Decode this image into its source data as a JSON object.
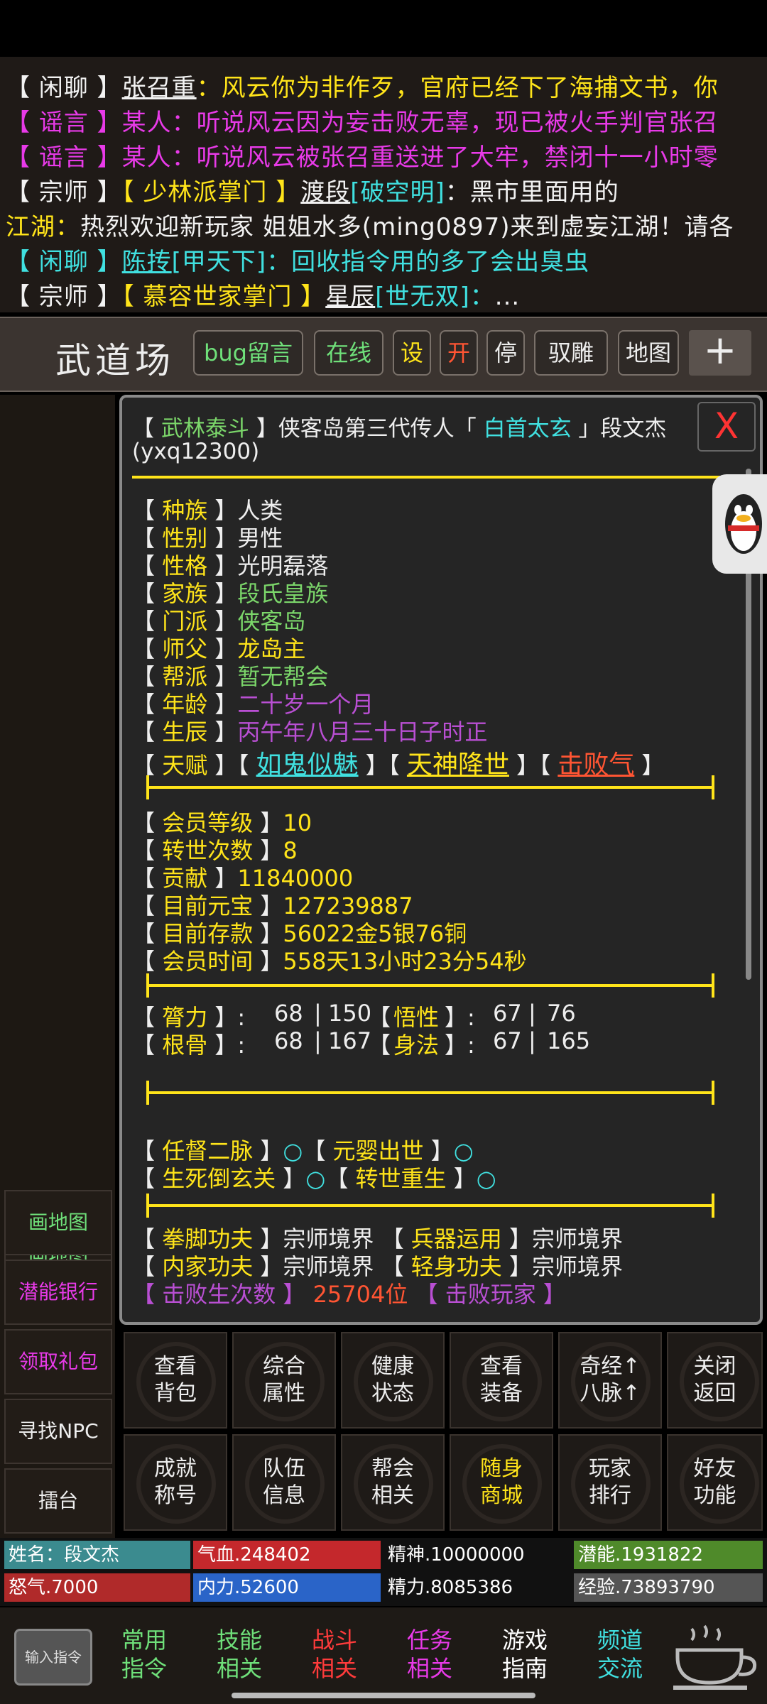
{
  "chat": [
    {
      "tag": "【 闲聊 】",
      "name": "张召重",
      "sep": "：",
      "msg": "风云你为非作歹，官府已经下了海捕文书，你"
    },
    {
      "tag": "【 谣言 】",
      "name": "某人",
      "sep": "：",
      "msg": "听说风云因为妄击败无辜，现已被火手判官张召"
    },
    {
      "tag": "【 谣言 】",
      "name": "某人",
      "sep": "：",
      "msg": "听说风云被张召重送进了大牢，禁闭十一小时零"
    },
    {
      "tag": "【 宗师 】",
      "title": "【 少林派掌门 】",
      "name": "渡段",
      "extra": "[破空明]",
      "sep": "：",
      "msg": "黑市里面用的"
    },
    {
      "tag": "江湖",
      "sep": "：",
      "msg": "热烈欢迎新玩家 姐姐水多(ming0897)来到虚妄江湖！请各"
    },
    {
      "tag": "【 闲聊 】",
      "name": "陈抟",
      "extra": "[甲天下]",
      "sep": "：",
      "msg": "回收指令用的多了会出臭虫"
    },
    {
      "tag": "【 宗师 】",
      "title": "【 慕容世家掌门 】",
      "name": "星辰",
      "extra": "[世无双]",
      "sep": "：",
      "msg": "..."
    }
  ],
  "toolbar": {
    "venue": "武道场",
    "buttons": [
      "bug留言",
      "在线",
      "设",
      "开",
      "停",
      "驭雕",
      "地图"
    ],
    "plus": "+"
  },
  "sidebar": [
    "画地图",
    "潜能银行",
    "领取礼包",
    "寻找NPC",
    "擂台"
  ],
  "profile": {
    "line1_a": "【 ",
    "title": "武林泰斗",
    "line1_b": " 】侠客岛第三代传人「 ",
    "nick": "白首太玄",
    "line1_c": " 」段文杰",
    "id": "(yxq12300)",
    "close": "X",
    "fields": [
      {
        "k": "种族",
        "v": "人类"
      },
      {
        "k": "性别",
        "v": "男性"
      },
      {
        "k": "性格",
        "v": "光明磊落"
      },
      {
        "k": "家族",
        "v": "段氏皇族"
      },
      {
        "k": "门派",
        "v": "侠客岛"
      },
      {
        "k": "师父",
        "v": "龙岛主"
      },
      {
        "k": "帮派",
        "v": "暂无帮会"
      },
      {
        "k": "年龄",
        "v": "二十岁一个月"
      },
      {
        "k": "生辰",
        "v": "丙午年八月三十日子时正"
      }
    ],
    "talent_label": "天赋",
    "talents": [
      "如鬼似魅",
      "天神降世",
      "击败气"
    ],
    "member": [
      {
        "k": "会员等级",
        "v": "10"
      },
      {
        "k": "转世次数",
        "v": "8"
      },
      {
        "k": "贡献",
        "v": "11840000"
      },
      {
        "k": "目前元宝",
        "v": "127239887"
      },
      {
        "k": "目前存款",
        "v": "56022金5银76铜"
      },
      {
        "k": "会员时间",
        "v": "558天13小时23分54秒"
      }
    ],
    "attrs": [
      {
        "k1": "膂力",
        "a": "68",
        "b": "150",
        "k2": "悟性",
        "c": "67",
        "d": "76"
      },
      {
        "k1": "根骨",
        "a": "68",
        "b": "167",
        "k2": "身法",
        "c": "67",
        "d": "165"
      }
    ],
    "states": [
      {
        "a": "任督二脉",
        "b": "元婴出世"
      },
      {
        "a": "生死倒玄关",
        "b": "转世重生"
      }
    ],
    "state_mark": "○",
    "skills": [
      {
        "k1": "拳脚功夫",
        "v1": "宗师境界",
        "k2": "兵器运用",
        "v2": "宗师境界"
      },
      {
        "k1": "内家功夫",
        "v1": "宗师境界",
        "k2": "轻身功夫",
        "v2": "宗师境界"
      }
    ],
    "rank_k1": "击败生次数",
    "rank_v1": "25704位",
    "rank_k2": "击败玩家"
  },
  "grid": [
    [
      "查看",
      "背包"
    ],
    [
      "综合",
      "属性"
    ],
    [
      "健康",
      "状态"
    ],
    [
      "查看",
      "装备"
    ],
    [
      "奇经↑",
      "八脉↑"
    ],
    [
      "关闭",
      "返回"
    ],
    [
      "成就",
      "称号"
    ],
    [
      "队伍",
      "信息"
    ],
    [
      "帮会",
      "相关"
    ],
    [
      "随身",
      "商城"
    ],
    [
      "玩家",
      "排行"
    ],
    [
      "好友",
      "功能"
    ]
  ],
  "stats": [
    {
      "t": "姓名：段文杰",
      "c": "#3b8b8f"
    },
    {
      "t": "气血.248402",
      "c": "#c4282c"
    },
    {
      "t": "精神.10000000",
      "c": "#111111"
    },
    {
      "t": "潜能.1931822",
      "c": "#4f8a2a"
    },
    {
      "t": "怒气.7000",
      "c": "#b02a2a"
    },
    {
      "t": "内力.52600",
      "c": "#2a64c8"
    },
    {
      "t": "精力.8085386",
      "c": "#111111"
    },
    {
      "t": "经验.73893790",
      "c": "#555555"
    }
  ],
  "bottom": {
    "input": "输入指令",
    "tabs": [
      [
        "常用",
        "指令"
      ],
      [
        "技能",
        "相关"
      ],
      [
        "战斗",
        "相关"
      ],
      [
        "任务",
        "相关"
      ],
      [
        "游戏",
        "指南"
      ],
      [
        "频道",
        "交流"
      ]
    ]
  },
  "colors": {
    "yellow": "#ffe41a",
    "cyan": "#40e0e0",
    "magenta": "#e83ae8",
    "green": "#7bd66a",
    "purple": "#b94fd3",
    "red": "#ff5533"
  }
}
